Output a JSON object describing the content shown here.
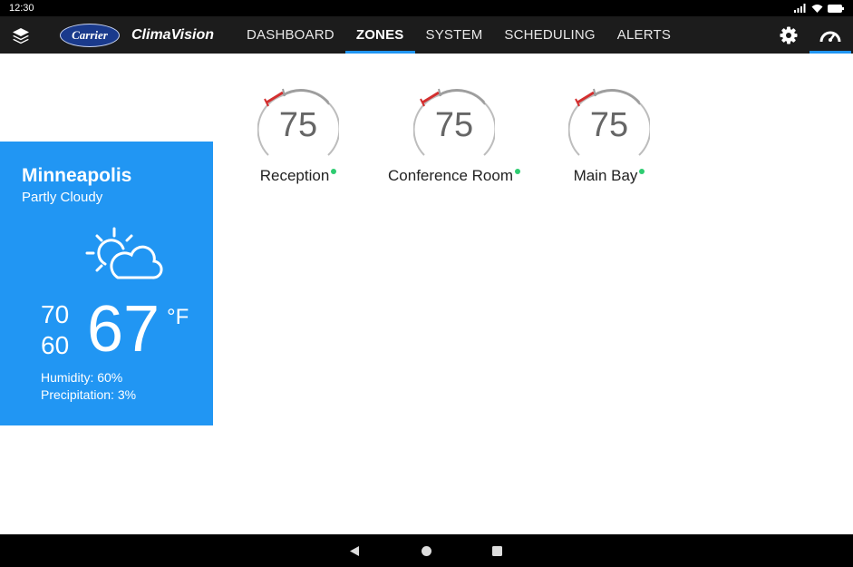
{
  "status": {
    "time": "12:30"
  },
  "header": {
    "brand_logo": "Carrier",
    "app_name": "ClimaVision",
    "tabs": [
      {
        "label": "DASHBOARD",
        "active": false
      },
      {
        "label": "ZONES",
        "active": true
      },
      {
        "label": "SYSTEM",
        "active": false
      },
      {
        "label": "SCHEDULING",
        "active": false
      },
      {
        "label": "ALERTS",
        "active": false
      }
    ],
    "accent": "#2196f3"
  },
  "weather": {
    "city": "Minneapolis",
    "condition": "Partly Cloudy",
    "icon": "partly-cloudy-icon",
    "high": "70",
    "low": "60",
    "current": "67",
    "unit": "°F",
    "humidity": "Humidity: 60%",
    "precipitation": "Precipitation: 3%",
    "bg_color": "#2196f3"
  },
  "zones": [
    {
      "name": "Reception",
      "temp": "75",
      "status_color": "#2ecc71"
    },
    {
      "name": "Conference Room",
      "temp": "75",
      "status_color": "#2ecc71"
    },
    {
      "name": "Main Bay",
      "temp": "75",
      "status_color": "#2ecc71"
    }
  ]
}
